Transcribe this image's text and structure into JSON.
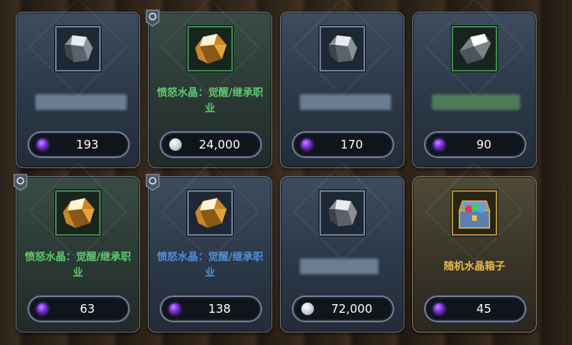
{
  "items": [
    {
      "name": "",
      "name_color": "",
      "price": "193",
      "currency_icon": "purple-gem-icon",
      "item_icon": "silver-crystal-icon"
    },
    {
      "name": "愤怒水晶：觉醒/继承职业",
      "name_color": "#5fc86e",
      "price": "24,000",
      "currency_icon": "silver-coin-icon",
      "item_icon": "gold-crystal-icon"
    },
    {
      "name": "",
      "name_color": "",
      "price": "170",
      "currency_icon": "purple-gem-icon",
      "item_icon": "silver-crystal-icon"
    },
    {
      "name": "",
      "name_color": "",
      "price": "90",
      "currency_icon": "purple-gem-icon",
      "item_icon": "white-crystal-icon"
    },
    {
      "name": "愤怒水晶：觉醒/继承职业",
      "name_color": "#5fc86e",
      "price": "63",
      "currency_icon": "purple-gem-icon",
      "item_icon": "gold-crystal-icon"
    },
    {
      "name": "愤怒水晶：觉醒/继承职业",
      "name_color": "#4f8fd6",
      "price": "138",
      "currency_icon": "purple-gem-icon",
      "item_icon": "gold-crystal-icon"
    },
    {
      "name": "",
      "name_color": "",
      "price": "72,000",
      "currency_icon": "silver-coin-icon",
      "item_icon": "silver-crystal-icon"
    },
    {
      "name": "随机水晶箱子",
      "name_color": "#e9b84a",
      "price": "45",
      "currency_icon": "purple-gem-icon",
      "item_icon": "treasure-chest-icon"
    }
  ]
}
